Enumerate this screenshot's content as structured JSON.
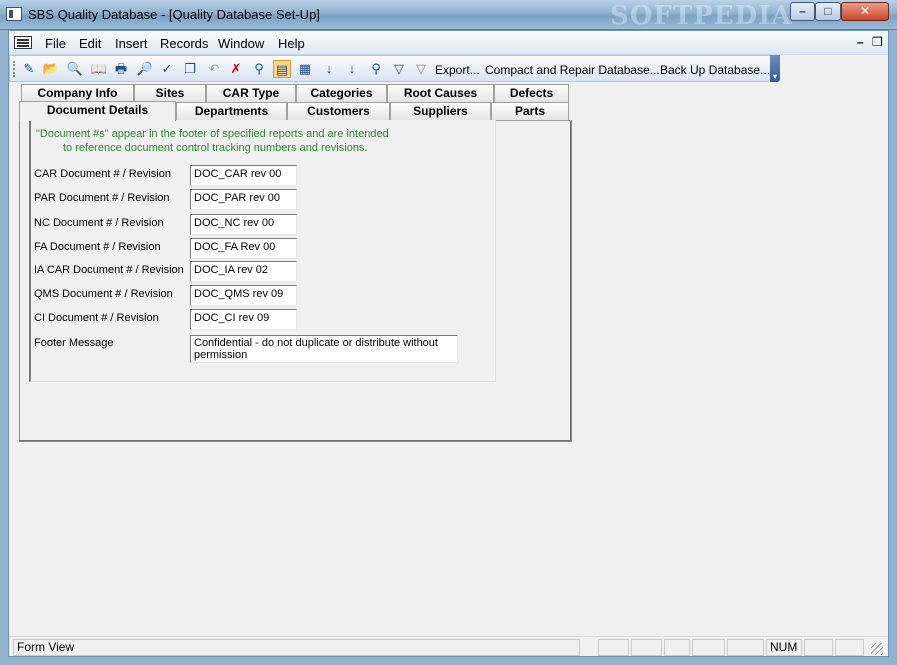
{
  "window": {
    "title": "SBS Quality Database - [Quality Database Set-Up]",
    "watermark": "SOFTPEDIA",
    "minimize": "–",
    "maximize": "□",
    "close": "✕"
  },
  "menubar": {
    "items": [
      {
        "label": "File"
      },
      {
        "label": "Edit"
      },
      {
        "label": "Insert"
      },
      {
        "label": "Records"
      },
      {
        "label": "Window"
      },
      {
        "label": "Help"
      }
    ],
    "mdi_minimize": "–",
    "mdi_restore": "❐"
  },
  "toolbar": {
    "icons": [
      "design-view-icon",
      "open-folder-icon",
      "find-file-icon",
      "open-book-icon",
      "print-icon",
      "print-preview-icon",
      "spelling-icon",
      "copy-icon",
      "undo-icon",
      "delete-icon",
      "find-icon",
      "form-view-icon",
      "datasheet-icon",
      "sort-ascending-icon",
      "sort-descending-icon",
      "filter-by-selection-icon",
      "filter-by-form-icon",
      "apply-filter-icon"
    ],
    "glyphs": [
      "✎",
      "📂",
      "🔍",
      "📖",
      "🖶",
      "🔎",
      "✓",
      "❐",
      "↶",
      "✗",
      "⚲",
      "▤",
      "▦",
      "↓",
      "↓",
      "⚲",
      "▽",
      "▽"
    ],
    "export_label": "Export...",
    "compact_label": "Compact and Repair Database...",
    "backup_label": "Back Up Database...",
    "overflow": "▾"
  },
  "tabs": {
    "row1": [
      "Company Info",
      "Sites",
      "CAR Type",
      "Categories",
      "Root Causes",
      "Defects"
    ],
    "row2": [
      "Document Details",
      "Departments",
      "Customers",
      "Suppliers",
      "Parts"
    ]
  },
  "info": {
    "line1": "\"Document #s\" appear in the footer of specified reports and are intended",
    "line2": "to reference document control tracking numbers and revisions."
  },
  "fields": [
    {
      "label": "CAR Document # / Revision",
      "value": "DOC_CAR rev 00"
    },
    {
      "label": "PAR Document # / Revision",
      "value": "DOC_PAR rev 00"
    },
    {
      "label": "NC Document # / Revision",
      "value": "DOC_NC  rev 00"
    },
    {
      "label": "FA Document # / Revision",
      "value": "DOC_FA  Rev 00"
    },
    {
      "label": "IA CAR Document # / Revision",
      "value": "DOC_IA rev 02"
    },
    {
      "label": "QMS Document # / Revision",
      "value": "DOC_QMS rev 09"
    },
    {
      "label": "CI Document # / Revision",
      "value": "DOC_CI rev 09"
    }
  ],
  "footer": {
    "label": "Footer Message",
    "value": "Confidential - do not duplicate or distribute without permission"
  },
  "statusbar": {
    "mode": "Form View",
    "num": "NUM"
  }
}
